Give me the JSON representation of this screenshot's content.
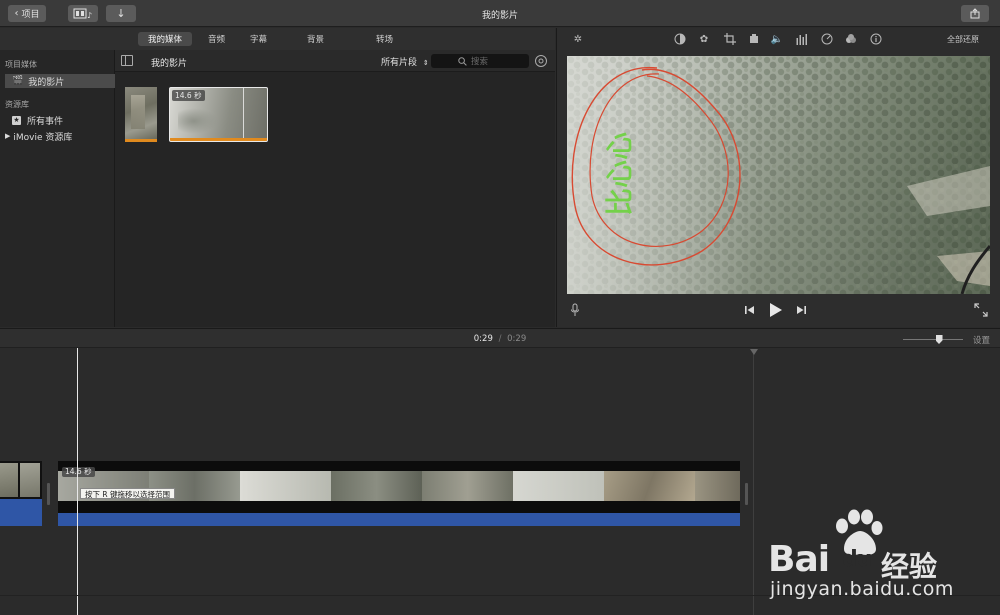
{
  "titlebar": {
    "back_label": "项目",
    "title": "我的影片"
  },
  "media_tabs": [
    {
      "label": "我的媒体",
      "active": true
    },
    {
      "label": "音频",
      "active": false
    },
    {
      "label": "字幕",
      "active": false
    },
    {
      "label": "背景",
      "active": false
    },
    {
      "label": "转场",
      "active": false
    }
  ],
  "sidebar": {
    "section_project": "项目媒体",
    "project_item": "我的影片",
    "section_library": "资源库",
    "library_all_events": "所有事件",
    "library_item": "iMovie 资源库"
  },
  "browser": {
    "title": "我的影片",
    "filter": "所有片段",
    "search_placeholder": "搜索",
    "clip_duration": "14.6 秒"
  },
  "viewer": {
    "reset_all": "全部还原",
    "overlay_text": "比心心"
  },
  "timeline": {
    "current_time": "0:29",
    "separator": "/",
    "total_time": "0:29",
    "settings_label": "设置",
    "clip_duration": "14.6 秒",
    "tooltip": "按下 R 键拖移以选择范围",
    "zoom_level": 0.6
  },
  "watermark": {
    "brand": "Bai",
    "brand2": "du",
    "cn": "经验",
    "url": "jingyan.baidu.com"
  },
  "colors": {
    "accent_orange": "#e08a1e",
    "audio_blue": "#2f56a6",
    "annotation_red": "#d84a32",
    "overlay_green": "#74d14a"
  }
}
